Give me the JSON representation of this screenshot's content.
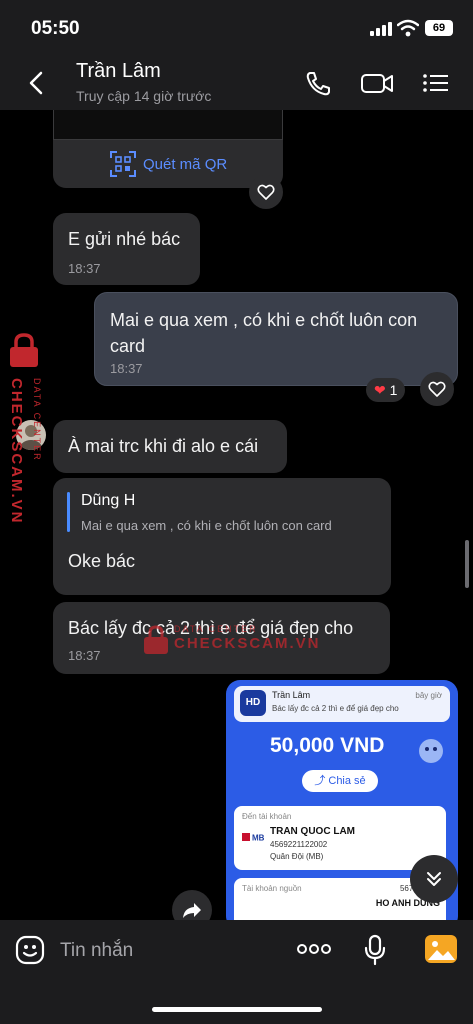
{
  "status_bar": {
    "time": "05:50",
    "battery": "69"
  },
  "header": {
    "contact_name": "Trần Lâm",
    "contact_status": "Truy cập 14 giờ trước"
  },
  "messages": {
    "qr_card": {
      "label": "Quét mã QR"
    },
    "m1": {
      "text": "E gửi nhé bác",
      "time": "18:37"
    },
    "m2": {
      "text": "Mai e qua xem , có khi e chốt luôn con card",
      "time": "18:37",
      "reaction_count": "1"
    },
    "m3": {
      "text": "À mai trc khi đi alo e cái"
    },
    "m4": {
      "quote_name": "Dũng H",
      "quote_text": "Mai e qua xem , có khi e chốt luôn con card",
      "text": "Oke bác"
    },
    "m5": {
      "text": "Bác lấy đc cả 2 thì e để giá đẹp cho",
      "time": "18:37"
    }
  },
  "receipt": {
    "notif_logo": "HD",
    "notif_title": "Trần Lâm",
    "notif_body": "Bác lấy đc cả 2 thì e để giá đẹp cho",
    "notif_time": "bây giờ",
    "amount": "50,000 VND",
    "share_label": "Chia sẻ",
    "to_label": "Đến tài khoản",
    "to_name": "TRAN QUOC LAM",
    "to_account": "4569221122002",
    "to_bank": "Quân Đội (MB)",
    "from_label": "Tài khoản nguồn",
    "from_account": "567898338",
    "from_name": "HO ANH DUNG"
  },
  "watermark": {
    "main": "CHECKSCAM.VN",
    "sub": "DATA CENTER"
  },
  "input": {
    "placeholder": "Tin nhắn"
  },
  "colors": {
    "accent": "#4a8cff",
    "bubble_in": "#2c2c2e",
    "bubble_out": "#3a3f4b",
    "watermark": "#c1272d"
  }
}
